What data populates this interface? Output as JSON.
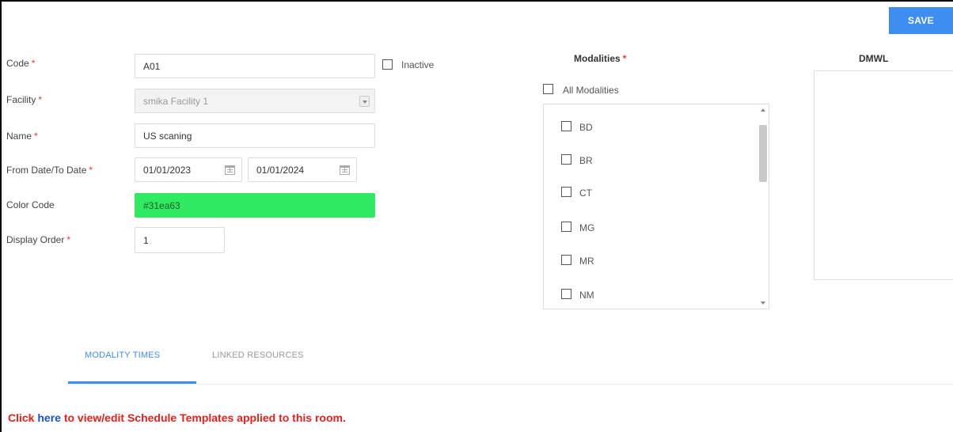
{
  "toolbar": {
    "save_label": "SAVE"
  },
  "form": {
    "code": {
      "label": "Code",
      "value": "A01"
    },
    "inactive_label": "Inactive",
    "facility": {
      "label": "Facility",
      "value": "smika Facility 1"
    },
    "name": {
      "label": "Name",
      "value": "US scaning"
    },
    "dates": {
      "label": "From Date/To Date",
      "from": "01/01/2023",
      "to": "01/01/2024"
    },
    "color_code": {
      "label": "Color Code",
      "value": "#31ea63",
      "color": "#31ea63"
    },
    "display_order": {
      "label": "Display Order",
      "value": "1"
    },
    "required_mark": "*"
  },
  "modalities": {
    "title": "Modalities",
    "all_label": "All Modalities",
    "items": [
      "BD",
      "BR",
      "CT",
      "MG",
      "MR",
      "NM"
    ]
  },
  "dmwl": {
    "title": "DMWL"
  },
  "tabs": [
    {
      "label": "MODALITY TIMES",
      "active": true
    },
    {
      "label": "LINKED RESOURCES",
      "active": false
    }
  ],
  "note": {
    "prefix": "Click ",
    "link": "here",
    "suffix": " to view/edit Schedule Templates applied to this room."
  },
  "colors": {
    "accent": "#3d8ef0",
    "required": "#e53935",
    "note": "#e8201a",
    "link": "#1a53c7"
  }
}
